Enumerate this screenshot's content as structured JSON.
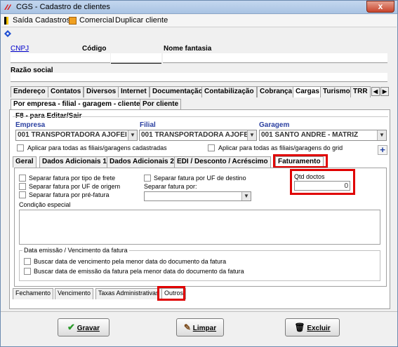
{
  "window": {
    "title": "CGS - Cadastro de clientes",
    "close_label": "x"
  },
  "menu": {
    "items": [
      {
        "label": "Saída"
      },
      {
        "label": "Cadastros"
      },
      {
        "label": "Comercial"
      },
      {
        "label": "Duplicar cliente"
      }
    ]
  },
  "header": {
    "cnpj_label": "CNPJ",
    "codigo_label": "Código",
    "nome_fantasia_label": "Nome fantasia",
    "razao_social_label": "Razão social"
  },
  "main_tabs": [
    "Endereço",
    "Contatos",
    "Diversos",
    "Internet",
    "Documentação",
    "Contabilização",
    "Cobrança",
    "Cargas",
    "Turismo",
    "TRR"
  ],
  "main_tabs_active": "Cargas",
  "sub_tabs": [
    "Por empresa - filial - garagem - cliente",
    "Por cliente"
  ],
  "edit_hint": "F8 - para Editar/Sair",
  "fields": {
    "empresa_label": "Empresa",
    "empresa_value": "001 TRANSPORTADORA AJOFEI",
    "filial_label": "Filial",
    "filial_value": "001 TRANSPORTADORA AJOFEI",
    "garagem_label": "Garagem",
    "garagem_value": "001 SANTO ANDRE - MATRIZ"
  },
  "apply_checks": {
    "filiais": "Aplicar para todas as filiais/garagens cadastradas",
    "grid": "Aplicar para todas as filiais/garagens do grid"
  },
  "plus_label": "+",
  "inner_tabs": [
    "Geral",
    "Dados Adicionais 1",
    "Dados Adicionais 2",
    "EDI / Desconto / Acréscimo",
    "Faturamento"
  ],
  "inner_tabs_active": "Faturamento",
  "faturamento": {
    "sep_tipo_frete": "Separar fatura por tipo de frete",
    "sep_uf_origem": "Separar fatura por UF de origem",
    "sep_pre_fatura": "Separar fatura por pré-fatura",
    "sep_uf_destino": "Separar fatura por UF de destino",
    "sep_por_label": "Separar fatura por:",
    "sep_por_value": "",
    "qtd_doctos_label": "Qtd doctos",
    "qtd_doctos_value": "0",
    "condicao_label": "Condição especial",
    "data_group_label": "Data emissão / Vencimento da fatura",
    "buscar_vencimento": "Buscar data de vencimento pela menor data do documento da fatura",
    "buscar_emissao": "Buscar data de emissão da fatura pela menor data do documento da fatura"
  },
  "bottom_tabs": [
    "Fechamento",
    "Vencimento",
    "Taxas Administrativas",
    "Outros"
  ],
  "bottom_tabs_active": "Outros",
  "buttons": {
    "gravar": "Gravar",
    "limpar": "Limpar",
    "excluir": "Excluir"
  },
  "colors": {
    "highlight": "#e00000",
    "title_bar": "#b7cde9",
    "link": "#0000cc"
  }
}
